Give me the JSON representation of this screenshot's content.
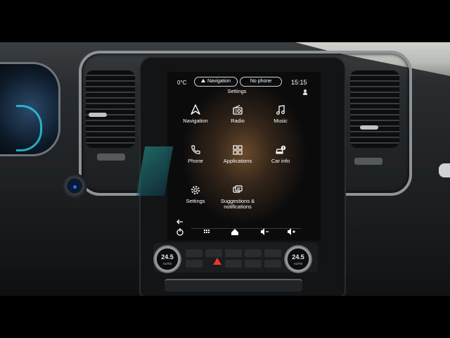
{
  "status": {
    "outside_temp": "0°C",
    "navigation_pill": "Navigation",
    "phone_pill": "No phone",
    "time": "15:15"
  },
  "screen_title": "Settings",
  "tiles": [
    {
      "label": "Navigation",
      "icon": "navigation-arrow-icon"
    },
    {
      "label": "Radio",
      "icon": "radio-icon"
    },
    {
      "label": "Music",
      "icon": "music-note-icon"
    },
    {
      "label": "Phone",
      "icon": "phone-icon"
    },
    {
      "label": "Applications",
      "icon": "apps-grid-icon"
    },
    {
      "label": "Car info",
      "icon": "car-info-icon"
    },
    {
      "label": "Settings",
      "icon": "gear-icon"
    },
    {
      "label": "Suggestions & notifications",
      "icon": "notifications-icon"
    }
  ],
  "bottom_bar_icons": [
    "back-icon",
    "power-icon",
    "app-grid-icon",
    "home-icon",
    "volume-down-icon",
    "volume-up-icon"
  ],
  "climate": {
    "left_temp": "24.5",
    "right_temp": "24.5",
    "left_fan": "AUTO",
    "right_fan": "AUTO"
  },
  "colors": {
    "accent_orange": "#6a4a2c",
    "screen_text": "#ffffff",
    "hazard_red": "#e33333"
  }
}
